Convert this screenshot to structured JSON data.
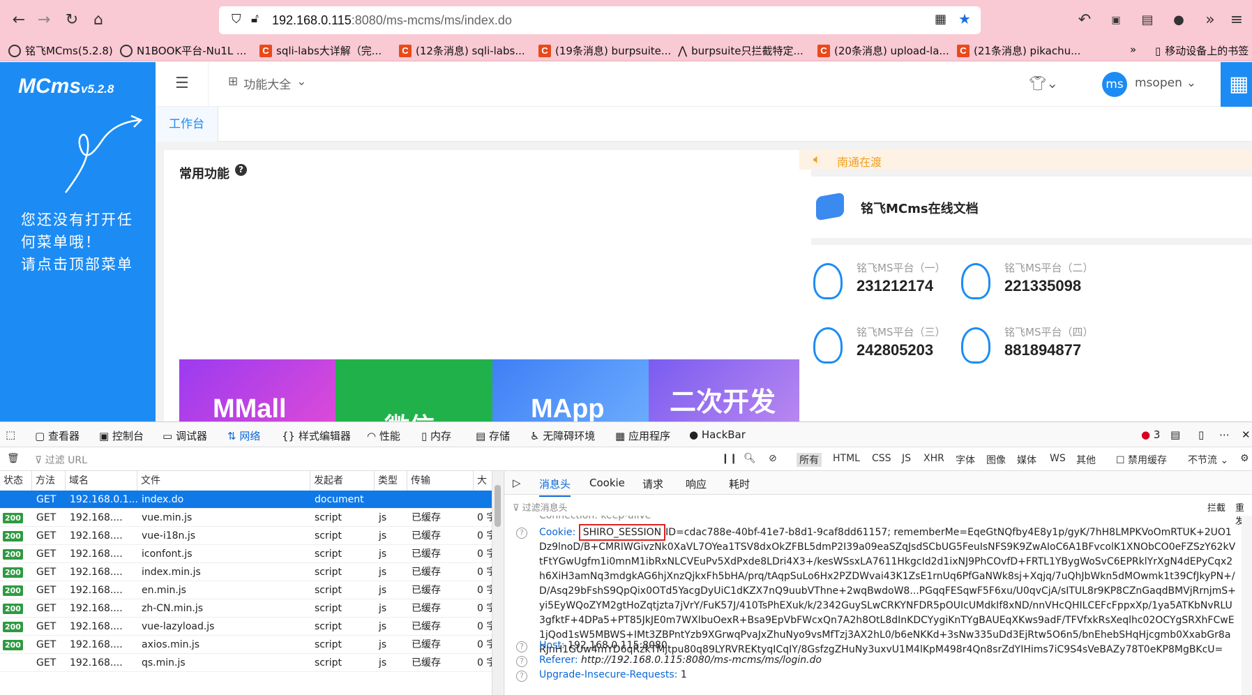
{
  "browser": {
    "url_host": "192.168.0.115",
    "url_rest": ":8080/ms-mcms/ms/index.do",
    "bookmarks": [
      "铭飞MCms(5.2.8)",
      "N1BOOK平台-Nu1L ...",
      "sqli-labs大详解（完...",
      "(12条消息) sqli-labs...",
      "(19条消息) burpsuite...",
      "burpsuite只拦截特定...",
      "(20条消息) upload-la...",
      "(21条消息) pikachu...",
      "移动设备上的书签"
    ]
  },
  "app": {
    "logo": "MCms",
    "logo_version": "v5.2.8",
    "side_hint": [
      "您还没有打开任",
      "何菜单哦！",
      "请点击顶部菜单"
    ],
    "menu_all": "功能大全",
    "avatar": "ms",
    "user": "msopen",
    "tab_workbench": "工作台",
    "common_title": "常用功能",
    "notice": "南通在渡",
    "doc_title": "铭飞MCms在线文档",
    "banners": [
      "MMall",
      "微信",
      "MApp",
      "二次开发"
    ],
    "qq": [
      {
        "label": "铭飞MS平台（一）",
        "num": "231212174"
      },
      {
        "label": "铭飞MS平台（二）",
        "num": "221335098"
      },
      {
        "label": "铭飞MS平台（三）",
        "num": "242805203"
      },
      {
        "label": "铭飞MS平台（四）",
        "num": "881894877"
      }
    ]
  },
  "devtools": {
    "tabs": [
      "查看器",
      "控制台",
      "调试器",
      "网络",
      "样式编辑器",
      "性能",
      "内存",
      "存储",
      "无障碍环境",
      "应用程序",
      "HackBar"
    ],
    "error_count": "3",
    "filter_placeholder": "过滤 URL",
    "type_filters": [
      "所有",
      "HTML",
      "CSS",
      "JS",
      "XHR",
      "字体",
      "图像",
      "媒体",
      "WS",
      "其他"
    ],
    "disable_cache": "禁用缓存",
    "throttle": "不节流",
    "columns": [
      "状态",
      "方法",
      "域名",
      "文件",
      "发起者",
      "类型",
      "传输",
      "大"
    ],
    "rows": [
      {
        "status": "",
        "method": "GET",
        "domain": "192.168.0.1...",
        "file": "index.do",
        "initiator": "document",
        "type": "",
        "transfer": "",
        "size": ""
      },
      {
        "status": "200",
        "method": "GET",
        "domain": "192.168....",
        "file": "vue.min.js",
        "initiator": "script",
        "type": "js",
        "transfer": "已缓存",
        "size": "0 字"
      },
      {
        "status": "200",
        "method": "GET",
        "domain": "192.168....",
        "file": "vue-i18n.js",
        "initiator": "script",
        "type": "js",
        "transfer": "已缓存",
        "size": "0 字"
      },
      {
        "status": "200",
        "method": "GET",
        "domain": "192.168....",
        "file": "iconfont.js",
        "initiator": "script",
        "type": "js",
        "transfer": "已缓存",
        "size": "0 字"
      },
      {
        "status": "200",
        "method": "GET",
        "domain": "192.168....",
        "file": "index.min.js",
        "initiator": "script",
        "type": "js",
        "transfer": "已缓存",
        "size": "0 字"
      },
      {
        "status": "200",
        "method": "GET",
        "domain": "192.168....",
        "file": "en.min.js",
        "initiator": "script",
        "type": "js",
        "transfer": "已缓存",
        "size": "0 字"
      },
      {
        "status": "200",
        "method": "GET",
        "domain": "192.168....",
        "file": "zh-CN.min.js",
        "initiator": "script",
        "type": "js",
        "transfer": "已缓存",
        "size": "0 字"
      },
      {
        "status": "200",
        "method": "GET",
        "domain": "192.168....",
        "file": "vue-lazyload.js",
        "initiator": "script",
        "type": "js",
        "transfer": "已缓存",
        "size": "0 字"
      },
      {
        "status": "200",
        "method": "GET",
        "domain": "192.168....",
        "file": "axios.min.js",
        "initiator": "script",
        "type": "js",
        "transfer": "已缓存",
        "size": "0 字"
      },
      {
        "status": "",
        "method": "GET",
        "domain": "192.168....",
        "file": "qs.min.js",
        "initiator": "script",
        "type": "js",
        "transfer": "已缓存",
        "size": "0 字"
      }
    ],
    "detail_tabs": [
      "消息头",
      "Cookie",
      "请求",
      "响应",
      "耗时"
    ],
    "filter_headers": "过滤消息头",
    "block": "拦截",
    "resend": "重发",
    "connection_partial": "Connection: keep-alive",
    "cookie_key": "Cookie:",
    "cookie_session": "SHIRO_SESSION",
    "cookie_value": "ID=cdac788e-40bf-41e7-b8d1-9caf8dd61157; rememberMe=EqeGtNQfby4E8y1p/gyK/7hH8LMPKVoOmRTUK+2UO1Dz9lnoD/B+CMRIWGivzNk0XaVL7OYea1TSV8dxOkZFBL5dmP2I39a09eaSZqJsdSCbUG5FeuIsNFS9K9ZwAIoC6A1BFvcolK1XNObCO0eFZSzY62kVtFtYGwUgfm1i0mnM1ibRxNLCVEuPv5XdPxde8LDri4X3+/kesWSsxLA7611HkgcId2d1ixNJ9PhCOvfD+FRTL1YBygWoSvC6EPRklYrXgN4dEPyCqx2h6XiH3amNq3mdgkAG6hjXnzQjkxFh5bHA/prq/tAqpSuLo6Hx2PZDWvai43K1ZsE1rnUq6PfGaNWk8sj+Xqjq/7uQhJbWkn5dMOwmk1t39CfJkyPN+/D/Asq29bFshS9QpQix0OTd5YacgDyUiC1dKZX7nQ9uubVThne+2wqBwdoW8...PGqqFESqwF5F6xu/U0qvCjA/sITUL8r9KP8CZnGaqdBMVjRrnjmS+yi5EyWQoZYM2gtHoZqtjzta7jVrY/FuK57J/410TsPhEXuk/k/2342GuySLwCRKYNFDR5pOUIcUMdkIf8xND/nnVHcQHILCEFcFppxXp/1ya5ATKbNvRLU3gfktF+4DPa5+PT85JkJE0m7WXlbuOexR+Bsa9EpVbFWcxQn7A2h8OtL8dInKDCYygiKnTYgBAUEqXKws9adF/TFVfxkRsXeqlhc02OCYgSRXhFCwE1jQod1sW5MBWS+IMt3ZBPntYzb9XGrwqPvaJxZhuNyo9vsMfTzj3AX2hL0/b6eNKKd+3sNw335uDd3EjRtw5O6n5/bnEhebSHqHjcgmb0XxabGr8aRJnH1GUw4mYD6qRzkTMjtpu80q89LYRVREKtyqICqIY/8GsfzgZHuNy3uxvU1M4lKpM498r4Qn8srZdYIHims7iC9S4sVeBAZy78T0eKP8MgBKcU=",
    "host_key": "Host:",
    "host_val": "192.168.0.115:8080",
    "referer_key": "Referer:",
    "referer_val": "http://192.168.0.115:8080/ms-mcms/ms/login.do",
    "upgrade_key": "Upgrade-Insecure-Requests:",
    "upgrade_val": "1"
  }
}
